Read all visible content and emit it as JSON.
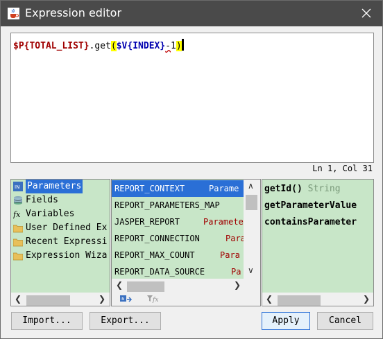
{
  "window": {
    "title": "Expression editor"
  },
  "editor": {
    "tokens": {
      "p_open": "$P{",
      "p_name": "TOTAL_LIST",
      "p_close": "}",
      "method": ".get",
      "paren_open": "(",
      "v_open": "$V{",
      "v_name": "INDEX",
      "v_close": "}",
      "minus": "-",
      "one": "1",
      "paren_close": ")"
    },
    "status": "Ln 1, Col 31"
  },
  "categories": [
    {
      "label": "Parameters",
      "icon": "parameters-icon",
      "selected": true
    },
    {
      "label": "Fields",
      "icon": "fields-database-icon",
      "selected": false
    },
    {
      "label": "Variables",
      "icon": "function-fx-icon",
      "selected": false
    },
    {
      "label": "User Defined Ex",
      "icon": "folder-icon",
      "selected": false
    },
    {
      "label": "Recent Expressi",
      "icon": "folder-icon",
      "selected": false
    },
    {
      "label": "Expression Wiza",
      "icon": "folder-icon",
      "selected": false
    }
  ],
  "items": [
    {
      "name": "REPORT_CONTEXT",
      "type": "Parame",
      "selected": true
    },
    {
      "name": "REPORT_PARAMETERS_MAP",
      "type": "",
      "selected": false
    },
    {
      "name": "JASPER_REPORT",
      "type": "Paramete",
      "selected": false
    },
    {
      "name": "REPORT_CONNECTION",
      "type": "Para",
      "selected": false
    },
    {
      "name": "REPORT_MAX_COUNT",
      "type": "Para",
      "selected": false
    },
    {
      "name": "REPORT_DATA_SOURCE",
      "type": "Pa",
      "selected": false
    }
  ],
  "methods": [
    {
      "name": "getId()",
      "returns": "String"
    },
    {
      "name": "getParameterValue",
      "returns": ""
    },
    {
      "name": "containsParameter",
      "returns": ""
    }
  ],
  "buttons": {
    "import": "Import...",
    "export": "Export...",
    "apply": "Apply",
    "cancel": "Cancel"
  },
  "colors": {
    "titlebar": "#4a4a4a",
    "panel_bg": "#c8e6c8",
    "selection": "#2a6fd6",
    "param_color": "#a00000",
    "var_color": "#0000b0"
  }
}
